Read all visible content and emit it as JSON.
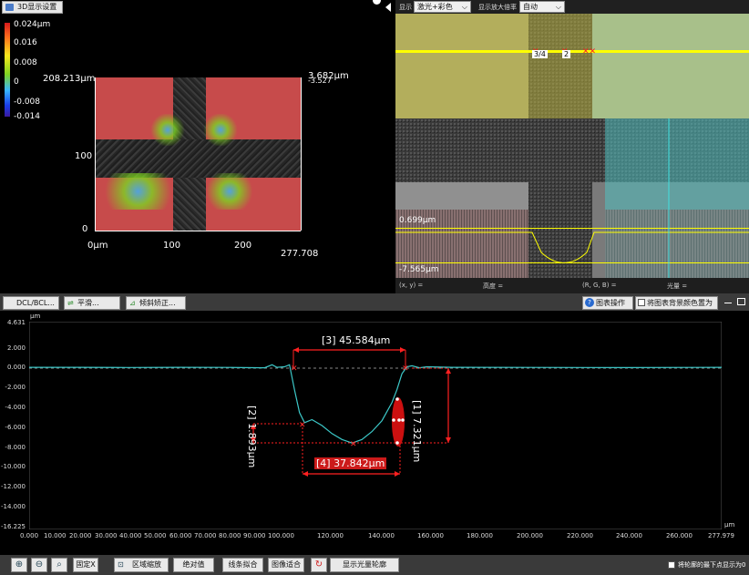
{
  "panel_3d": {
    "settings_button": "3D显示设置",
    "colorbar_labels": [
      "0.024µm",
      "0.016",
      "0.008",
      "0",
      "-0.008",
      "-0.014"
    ],
    "top_left_value": "208.213µm",
    "top_right_value": "3.682µm",
    "top_right_value2": "-3.527",
    "y_ticks": [
      "100",
      "0"
    ],
    "x_ticks": [
      "0µm",
      "100",
      "200"
    ],
    "x_end_value": "277.708"
  },
  "camera": {
    "display_label": "显示",
    "display_mode": "激光+彩色",
    "zoom_label": "显示放大倍率",
    "zoom_mode": "自动",
    "marker_1": "3/4",
    "marker_2": "2",
    "upper_height": "0.699µm",
    "lower_height": "-7.565µm",
    "status": {
      "xy": "(x, y)  =",
      "height": "高度  =",
      "rgb": "(R, G, B)  =",
      "intensity": "光量  ="
    }
  },
  "tabs": {
    "t1": "DCL/BCL...",
    "t2": "平滑...",
    "t3": "倾斜矫正...",
    "chart_ops": "图表操作",
    "bg_white": "将图表背景颜色置为白色"
  },
  "profile": {
    "y_unit": "µm",
    "x_unit": "µm",
    "y_ticks": [
      "4.631",
      "2.000",
      "0.000",
      "-2.000",
      "-4.000",
      "-6.000",
      "-8.000",
      "-10.000",
      "-12.000",
      "-14.000",
      "-16.225"
    ],
    "x_ticks": [
      "0.000",
      "10.000",
      "20.000",
      "30.000",
      "40.000",
      "50.000",
      "60.000",
      "70.000",
      "80.000",
      "90.000",
      "100.000",
      "120.000",
      "140.000",
      "160.000",
      "180.000",
      "200.000",
      "220.000",
      "240.000",
      "260.000",
      "277.979"
    ],
    "measure_3": "[3] 45.584µm",
    "measure_1": "[1] 7.321µm",
    "measure_2": "[2] 1.893µm",
    "measure_4": "[4] 37.842µm"
  },
  "chart_data": {
    "type": "line",
    "xlabel": "µm",
    "ylabel": "µm",
    "xlim": [
      0,
      277.979
    ],
    "ylim": [
      -16.225,
      4.631
    ],
    "series": [
      {
        "x": [
          0,
          20,
          40,
          60,
          80,
          95,
          98,
          100,
          103,
          105,
          107,
          109,
          111,
          114,
          118,
          122,
          126,
          130,
          134,
          138,
          142,
          146,
          148,
          150,
          152,
          154,
          157,
          160,
          170,
          200,
          240,
          277.979
        ],
        "values": [
          0.05,
          0.05,
          0.03,
          0.05,
          0.04,
          0.0,
          0.3,
          0.05,
          0.1,
          0.3,
          -2.2,
          -4.5,
          -5.5,
          -5.2,
          -5.8,
          -6.6,
          -7.2,
          -7.55,
          -7.2,
          -6.4,
          -5.3,
          -3.5,
          -2.2,
          -0.6,
          0.1,
          0.2,
          0.0,
          0.1,
          0.05,
          0.04,
          0.02,
          0.05
        ]
      }
    ],
    "annotations": [
      "[3] 45.584µm",
      "[1] 7.321µm",
      "[2] 1.893µm",
      "[4] 37.842µm"
    ]
  },
  "toolbar": {
    "fix_x": "固定X",
    "area_zoom": "区域缩放",
    "abs_value": "绝对值",
    "line_fit": "线条拟合",
    "image_fit": "图像适合",
    "show_profile": "显示光量轮廓",
    "show_zero": "将轮廓的最下点显示为0"
  }
}
